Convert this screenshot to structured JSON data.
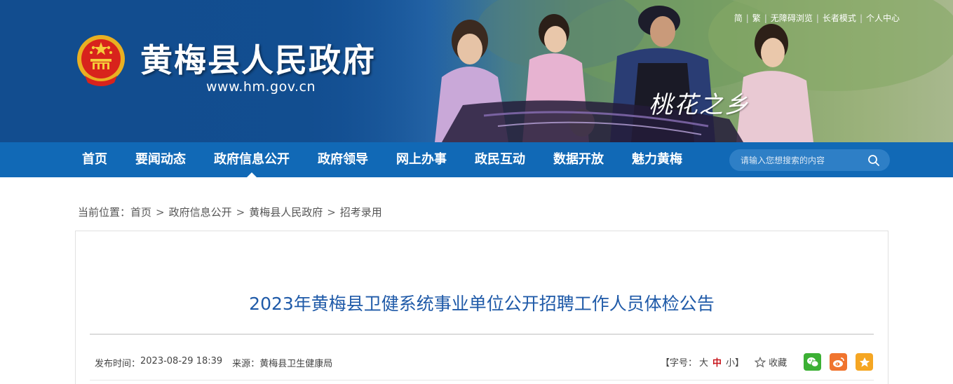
{
  "header": {
    "site_title": "黄梅县人民政府",
    "site_url": "www.hm.gov.cn",
    "slogan": "桃花之乡",
    "top_links": [
      "简",
      "繁",
      "无障碍浏览",
      "长者模式",
      "个人中心"
    ]
  },
  "nav": {
    "items": [
      "首页",
      "要闻动态",
      "政府信息公开",
      "政府领导",
      "网上办事",
      "政民互动",
      "数据开放",
      "魅力黄梅"
    ],
    "active": "政府信息公开",
    "search_placeholder": "请输入您想搜索的内容"
  },
  "breadcrumb": {
    "prefix": "当前位置：",
    "items": [
      "首页",
      "政府信息公开",
      "黄梅县人民政府",
      "招考录用"
    ]
  },
  "article": {
    "title": "2023年黄梅县卫健系统事业单位公开招聘工作人员体检公告",
    "publish_label": "发布时间：",
    "publish_time": "2023-08-29 18:39",
    "source_label": "来源：",
    "source": "黄梅县卫生健康局",
    "font_size_label": "【字号：",
    "font_large": "大",
    "font_medium": "中",
    "font_small": "小】",
    "favorite_label": "收藏"
  },
  "share": {
    "icons": [
      "wechat-icon",
      "weibo-icon",
      "star-icon"
    ]
  },
  "colors": {
    "nav_bg": "#1169b6",
    "title_blue": "#1f5aa8",
    "active_font": "#c8161d"
  }
}
